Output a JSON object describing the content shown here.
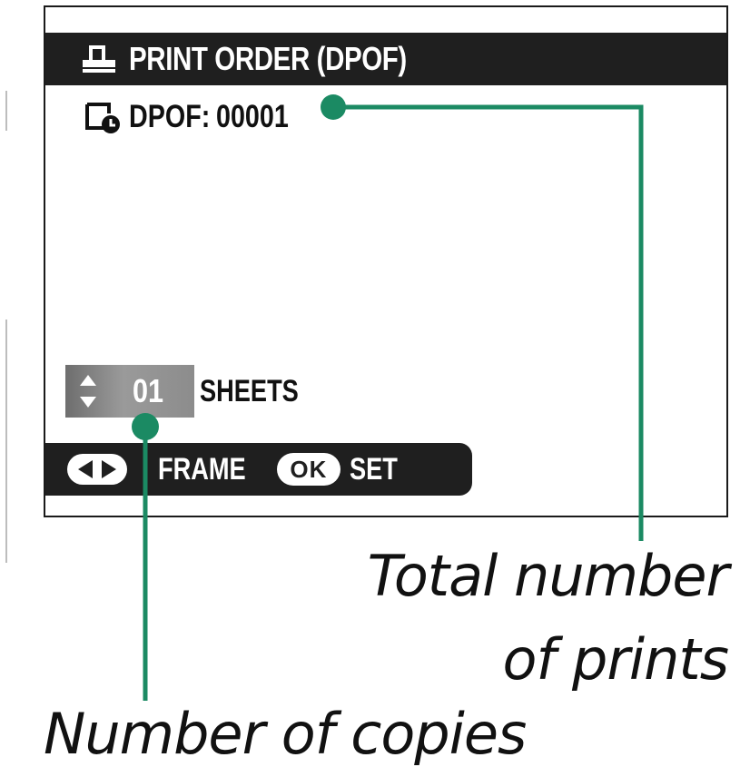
{
  "screen": {
    "title": "PRINT ORDER (DPOF)",
    "dpof_label": "DPOF:",
    "dpof_count": "00001",
    "copies_value": "01",
    "sheets_label": "SHEETS",
    "frame_label": "FRAME",
    "ok_label": "OK",
    "set_label": "SET"
  },
  "callouts": {
    "total_prints_line1": "Total number",
    "total_prints_line2": "of prints",
    "copies": "Number of copies"
  },
  "icons": {
    "title": "printer-icon",
    "dpof": "dpof-clock-icon",
    "stepper": "up-down-arrows-icon",
    "frame": "left-right-arrows-icon"
  },
  "colors": {
    "callout_accent": "#1b8a63",
    "bar_background": "#1f1f1f"
  }
}
